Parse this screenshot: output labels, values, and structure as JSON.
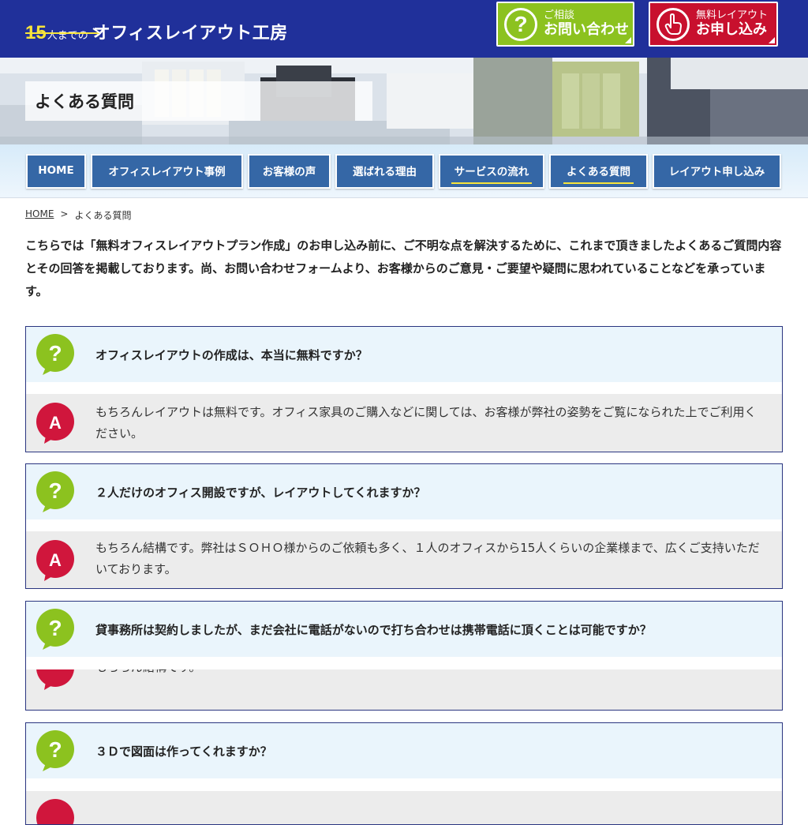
{
  "header": {
    "logo_num": "15",
    "logo_small": "人までの",
    "logo_main": "オフィスレイアウト工房",
    "contact_btn": {
      "icon": "?",
      "sub": "ご相談",
      "main": "お問い合わせ"
    },
    "apply_btn": {
      "sub": "無料レイアウト",
      "main": "お申し込み"
    }
  },
  "hero": {
    "title": "よくある質問"
  },
  "nav": {
    "items": [
      {
        "label": "HOME"
      },
      {
        "label": "オフィスレイアウト事例"
      },
      {
        "label": "お客様の声"
      },
      {
        "label": "選ばれる理由"
      },
      {
        "label": "サービスの流れ"
      },
      {
        "label": "よくある質問"
      },
      {
        "label": "レイアウト申し込み"
      }
    ]
  },
  "breadcrumb": {
    "home": "HOME",
    "separator": ">",
    "current": "よくある質問"
  },
  "intro": "こちらでは「無料オフィスレイアウトプラン作成」のお申し込み前に、ご不明な点を解決するために、これまで頂きましたよくあるご質問内容とその回答を掲載しております。尚、お問い合わせフォームより、お客様からのご意見・ご要望や疑問に思われていることなどを承っています。",
  "faq_icons": {
    "q": "?",
    "a": "A"
  },
  "faqs": [
    {
      "q": "オフィスレイアウトの作成は、本当に無料ですか？",
      "a": "もちろんレイアウトは無料です。オフィス家具のご購入などに関しては、お客様が弊社の姿勢をご覧になられた上でご利用ください。"
    },
    {
      "q": "２人だけのオフィス開設ですが、レイアウトしてくれますか？",
      "a": "もちろん結構です。弊社はＳＯＨＯ様からのご依頼も多く、１人のオフィスから15人くらいの企業様まで、広くご支持いただいております。"
    },
    {
      "q": "貸事務所は契約しましたが、まだ会社に電話がないので打ち合わせは携帯電話に頂くことは可能ですか？",
      "a": "もちろん結構です。"
    },
    {
      "q": "３Ｄで図面は作ってくれますか？",
      "a": ""
    }
  ],
  "colors": {
    "header_bg": "#20309a",
    "logo_accent": "#f7e43a",
    "contact_green": "#8cc21f",
    "apply_red": "#c8102e",
    "nav_blue": "#3567a6",
    "question_bg": "#eaf5fc",
    "answer_bg": "#ececec",
    "a_icon_red": "#d0163c",
    "q_icon_green": "#8cc21f"
  }
}
